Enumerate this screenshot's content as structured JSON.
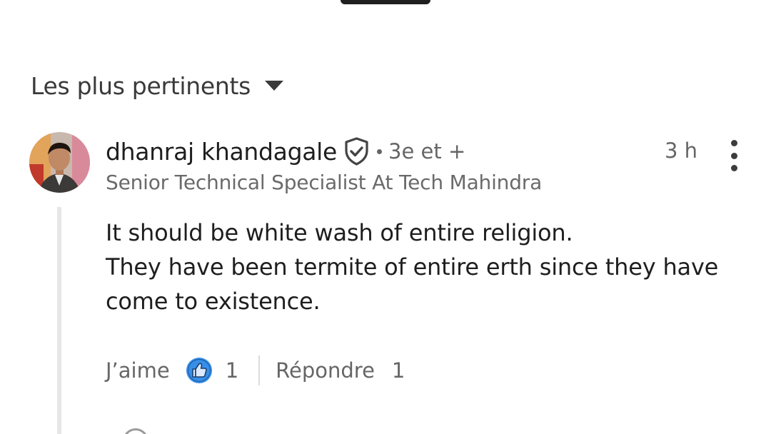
{
  "sort": {
    "label": "Les plus pertinents",
    "caret_icon": "caret-down-icon"
  },
  "comment": {
    "author": "dhanraj khandagale",
    "verified_icon": "shield-check-icon",
    "degree": "3e et +",
    "time": "3 h",
    "headline": "Senior Technical Specialist At Tech Mahindra",
    "body_lines": [
      "It should be white wash of entire religion.",
      "They have been termite of entire erth since they have",
      "come to existence."
    ],
    "actions": {
      "like_label": "J’aime",
      "like_icon": "thumbs-up-icon",
      "like_count": "1",
      "reply_label": "Répondre",
      "reply_count": "1"
    }
  },
  "colors": {
    "text_primary": "#1e1e1e",
    "text_secondary": "#666666",
    "like_blue": "#378fe9",
    "thread_line": "#e6e6e6"
  }
}
